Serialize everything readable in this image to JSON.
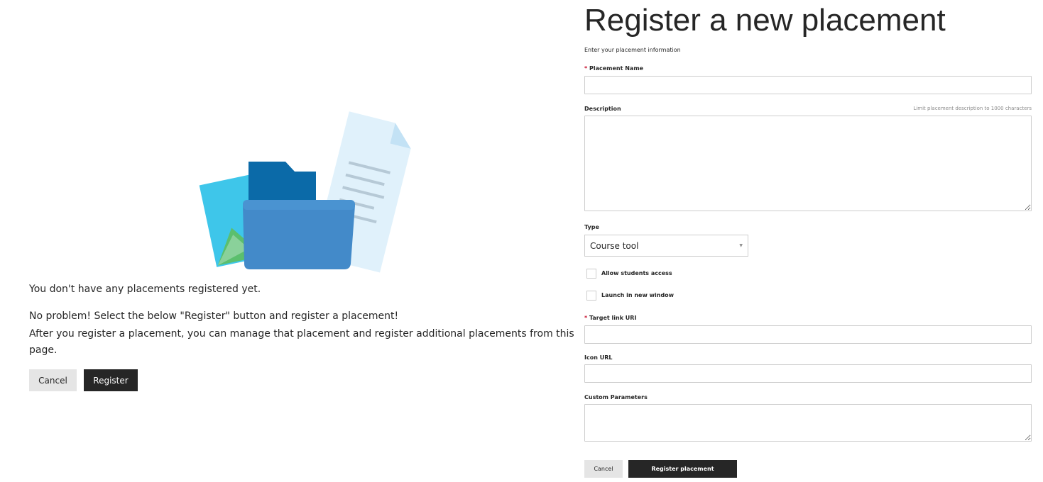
{
  "empty_state": {
    "title": "You don't have any placements registered yet.",
    "line1": "No problem! Select the below \"Register\" button and register a placement!",
    "line2": "After you register a placement, you can manage that placement and register additional placements from this",
    "line3": "page.",
    "cancel_label": "Cancel",
    "register_label": "Register",
    "illustration_icon": "folder-documents-illustration"
  },
  "form": {
    "title": "Register a new placement",
    "subtitle": "Enter your placement information",
    "required_marker": "*",
    "placement_name": {
      "label": "Placement Name",
      "value": ""
    },
    "description": {
      "label": "Description",
      "hint": "Limit placement description to 1000 characters",
      "value": ""
    },
    "type": {
      "label": "Type",
      "selected": "Course tool"
    },
    "allow_students_access": {
      "label": "Allow students access",
      "checked": false
    },
    "launch_new_window": {
      "label": "Launch in new window",
      "checked": false
    },
    "target_link_uri": {
      "label": "Target link URI",
      "value": ""
    },
    "icon_url": {
      "label": "Icon URL",
      "value": ""
    },
    "custom_parameters": {
      "label": "Custom Parameters",
      "value": ""
    },
    "cancel_label": "Cancel",
    "submit_label": "Register placement"
  },
  "colors": {
    "required": "#c8102e",
    "primary_button": "#262626",
    "secondary_button": "#e5e5e5",
    "input_border": "#cdcdcd"
  }
}
